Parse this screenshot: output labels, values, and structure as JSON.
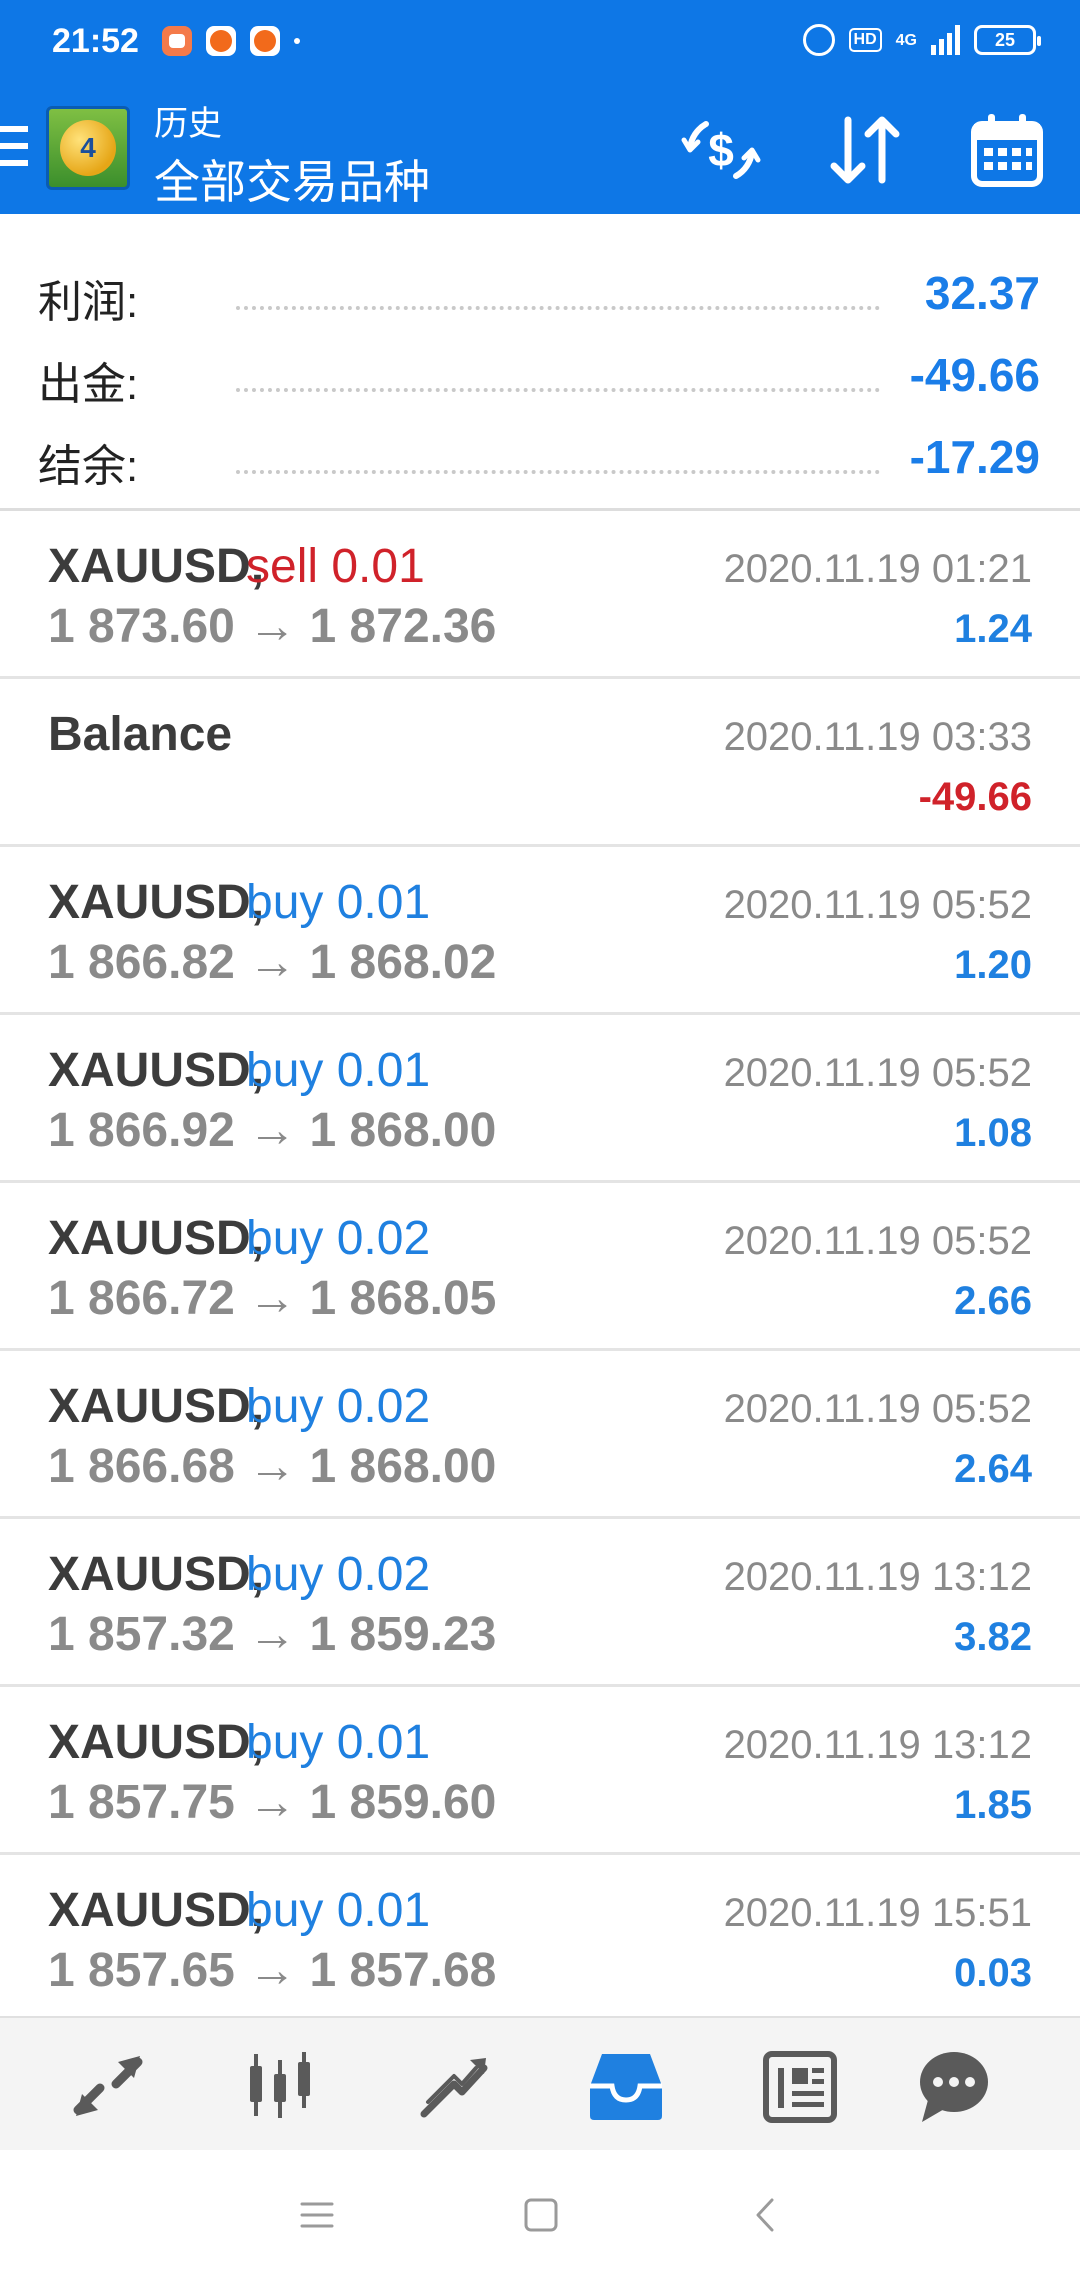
{
  "status_bar": {
    "time": "21:52",
    "hd": "HD",
    "network": "4G",
    "battery": "25"
  },
  "header": {
    "title": "历史",
    "subtitle": "全部交易品种",
    "toolbar": [
      "currency-exchange-icon",
      "sort-icon",
      "calendar-icon"
    ]
  },
  "summary": {
    "profit_label": "利润:",
    "profit_value": "32.37",
    "withdrawal_label": "出金:",
    "withdrawal_value": "-49.66",
    "balance_label": "结余:",
    "balance_value": "-17.29"
  },
  "deals": [
    {
      "symbol": "XAUUSD,",
      "direction": "sell 0.01",
      "type": "sell",
      "prices": "1 873.60 → 1 872.36",
      "time": "2020.11.19 01:21",
      "profit": "1.24"
    },
    {
      "symbol": "Balance",
      "direction": "",
      "type": "balance",
      "prices": "",
      "time": "2020.11.19 03:33",
      "profit": "-49.66"
    },
    {
      "symbol": "XAUUSD,",
      "direction": "buy 0.01",
      "type": "buy",
      "prices": "1 866.82 → 1 868.02",
      "time": "2020.11.19 05:52",
      "profit": "1.20"
    },
    {
      "symbol": "XAUUSD,",
      "direction": "buy 0.01",
      "type": "buy",
      "prices": "1 866.92 → 1 868.00",
      "time": "2020.11.19 05:52",
      "profit": "1.08"
    },
    {
      "symbol": "XAUUSD,",
      "direction": "buy 0.02",
      "type": "buy",
      "prices": "1 866.72 → 1 868.05",
      "time": "2020.11.19 05:52",
      "profit": "2.66"
    },
    {
      "symbol": "XAUUSD,",
      "direction": "buy 0.02",
      "type": "buy",
      "prices": "1 866.68 → 1 868.00",
      "time": "2020.11.19 05:52",
      "profit": "2.64"
    },
    {
      "symbol": "XAUUSD,",
      "direction": "buy 0.02",
      "type": "buy",
      "prices": "1 857.32 → 1 859.23",
      "time": "2020.11.19 13:12",
      "profit": "3.82"
    },
    {
      "symbol": "XAUUSD,",
      "direction": "buy 0.01",
      "type": "buy",
      "prices": "1 857.75 → 1 859.60",
      "time": "2020.11.19 13:12",
      "profit": "1.85"
    },
    {
      "symbol": "XAUUSD,",
      "direction": "buy 0.01",
      "type": "buy",
      "prices": "1 857.65 → 1 857.68",
      "time": "2020.11.19 15:51",
      "profit": "0.03"
    }
  ],
  "bottom_nav": {
    "items": [
      "quotes-icon",
      "chart-icon",
      "trade-icon",
      "history-icon",
      "news-icon",
      "chat-icon"
    ],
    "active": "history-icon"
  },
  "colors": {
    "header": "#0e77e6",
    "accent_blue": "#1f80e0",
    "sell_red": "#d0222a",
    "text_gray": "#8a8a8a"
  }
}
